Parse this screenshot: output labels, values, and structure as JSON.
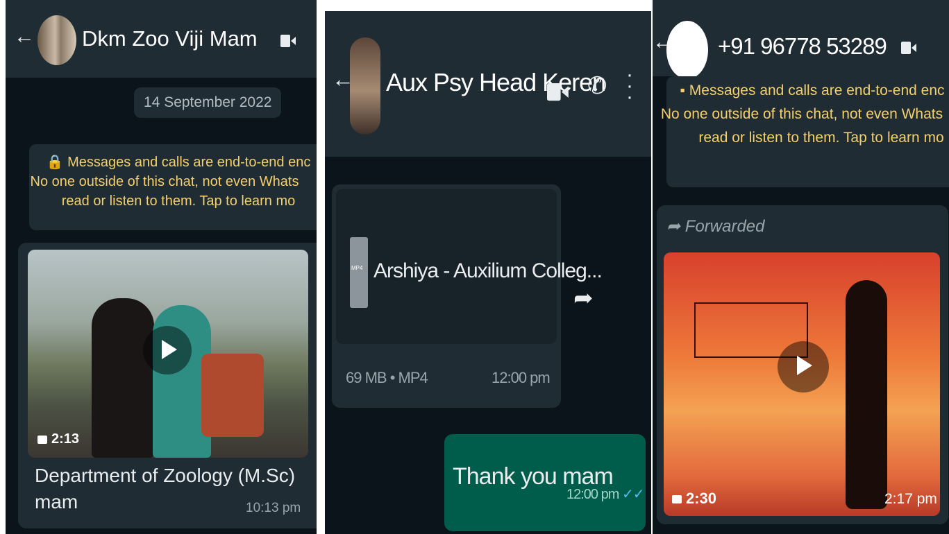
{
  "chat1": {
    "title": "Dkm Zoo Viji Mam",
    "date": "14 September 2022",
    "encryption": [
      "🔒 Messages and calls are end-to-end enc",
      "No one outside of this chat, not even Whats",
      "read or listen to them. Tap to learn mo"
    ],
    "video_duration": "2:13",
    "caption_line1": "Department of Zoology  (M.Sc)",
    "caption_line2": "mam",
    "time": "10:13 pm"
  },
  "chat2": {
    "title": "Aux Psy Head Keren",
    "file_name": "Arshiya - Auxilium Colleg...",
    "file_ext": "MP4",
    "file_meta": "69 MB • MP4",
    "file_time": "12:00 pm",
    "reply_text": "Thank you mam",
    "reply_time": "12:00 pm",
    "ticks": "✓✓"
  },
  "chat3": {
    "title": "+91 96778 53289",
    "encryption": [
      "▪ Messages and calls are end-to-end enc",
      "No one outside of this chat, not even Whats",
      "read or listen to them. Tap to learn mo"
    ],
    "forwarded": "Forwarded",
    "video_duration": "2:30",
    "time": "2:17 pm"
  },
  "colors": {
    "header": "#1f2c34",
    "chat_bg": "#0b141a",
    "sent_bubble": "#005c4b",
    "encryption_text": "#f5cf6c",
    "tick_blue": "#53bdeb"
  },
  "icons": [
    "back-arrow-icon",
    "video-call-icon",
    "voice-call-icon",
    "more-menu-icon",
    "play-icon",
    "video-camera-icon",
    "share-icon",
    "forward-icon",
    "lock-icon",
    "file-icon"
  ]
}
